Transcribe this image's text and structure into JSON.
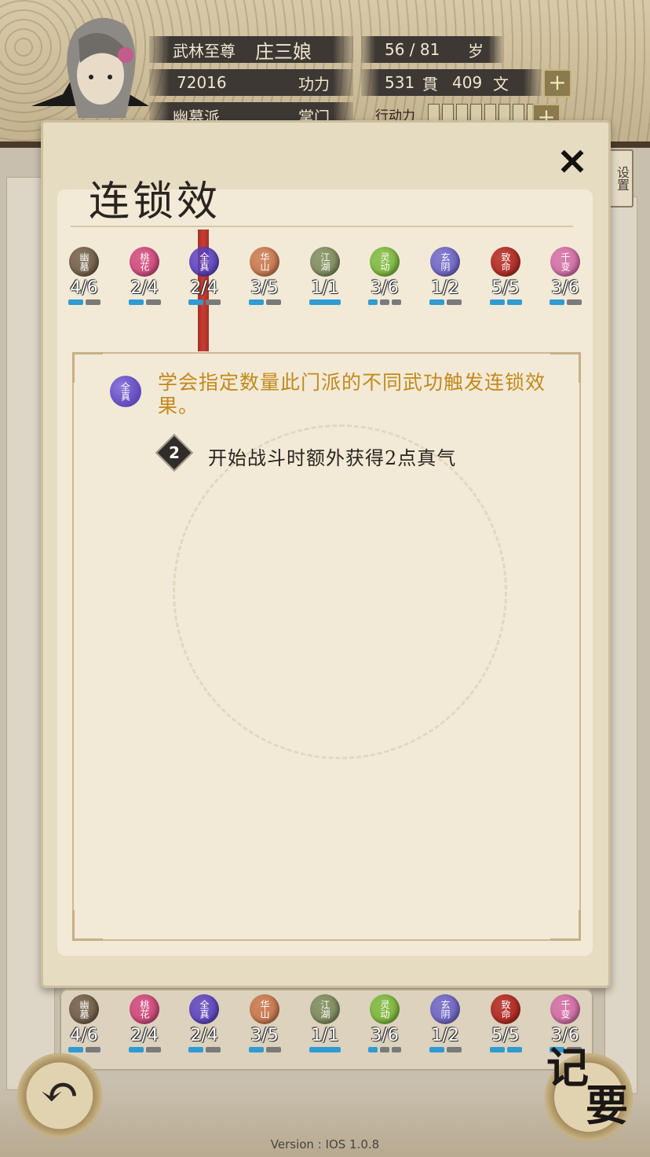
{
  "header": {
    "title_rank": "武林至尊",
    "name": "庄三娘",
    "age": "56 / 81",
    "age_unit": "岁",
    "power_value": "72016",
    "power_label": "功力",
    "money_guan": "531",
    "guan_label": "貫",
    "money_wen": "409",
    "wen_label": "文",
    "sect": "幽墓派",
    "sect_role": "掌门",
    "action_label": "行动力",
    "plus": "+"
  },
  "dialog": {
    "title": "连锁效",
    "close": "✕",
    "settings": "设置"
  },
  "sects": [
    {
      "name": "幽墓",
      "count": "4/6",
      "color": "#6e5a44",
      "bars": [
        1,
        0
      ]
    },
    {
      "name": "桃花",
      "count": "2/4",
      "color": "#d0437a",
      "bars": [
        1,
        0
      ]
    },
    {
      "name": "全真",
      "count": "2/4",
      "color": "#5a40c0",
      "bars": [
        1,
        0
      ]
    },
    {
      "name": "华山",
      "count": "3/5",
      "color": "#c8754a",
      "bars": [
        1,
        0
      ]
    },
    {
      "name": "江湖",
      "count": "1/1",
      "color": "#7a8a5a",
      "bars": [
        1
      ]
    },
    {
      "name": "灵动",
      "count": "3/6",
      "color": "#7ab83a",
      "bars": [
        1,
        0,
        0
      ]
    },
    {
      "name": "玄阴",
      "count": "1/2",
      "color": "#6a62c8",
      "bars": [
        1,
        0
      ]
    },
    {
      "name": "致命",
      "count": "5/5",
      "color": "#b0221c",
      "bars": [
        1,
        1
      ]
    },
    {
      "name": "千变",
      "count": "3/6",
      "color": "#d26aa6",
      "bars": [
        1,
        0
      ]
    }
  ],
  "description": {
    "icon_label": "全真",
    "text": "学会指定数量此门派的不同武功触发连锁效果。",
    "tier": "2",
    "tier_text": "开始战斗时额外获得2点真气"
  },
  "bottom": {
    "back": "↶",
    "memo_1": "记",
    "memo_2": "要",
    "version": "Version : IOS 1.0.8"
  }
}
